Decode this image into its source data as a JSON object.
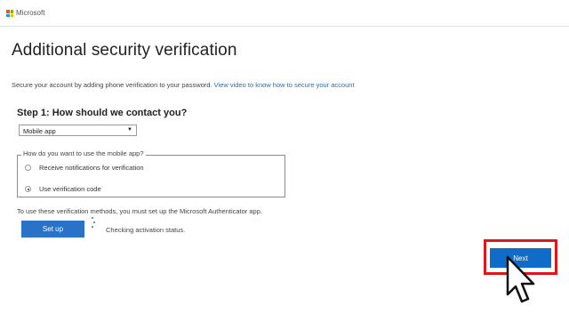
{
  "header": {
    "brand": "Microsoft",
    "logo_colors": [
      "#f25022",
      "#7fba00",
      "#00a4ef",
      "#ffb900"
    ]
  },
  "page": {
    "title": "Additional security verification",
    "intro_text": "Secure your account by adding phone verification to your password.",
    "intro_link": "View video to know how to secure your account"
  },
  "step1": {
    "title": "Step 1: How should we contact you?",
    "contact_method": {
      "selected": "Mobile app"
    },
    "mobile_app_group": {
      "legend": "How do you want to use the mobile app?",
      "options": [
        {
          "label": "Receive notifications for verification",
          "checked": false
        },
        {
          "label": "Use verification code",
          "checked": true
        }
      ]
    },
    "note": "To use these verification methods, you must set up the Microsoft Authenticator app.",
    "setup_button": "Set up",
    "status": "Checking activation status."
  },
  "footer": {
    "next_button": "Next"
  },
  "colors": {
    "primary_button": "#2a72c8",
    "highlight_box": "#e0161e",
    "link": "#2b6cb0"
  }
}
